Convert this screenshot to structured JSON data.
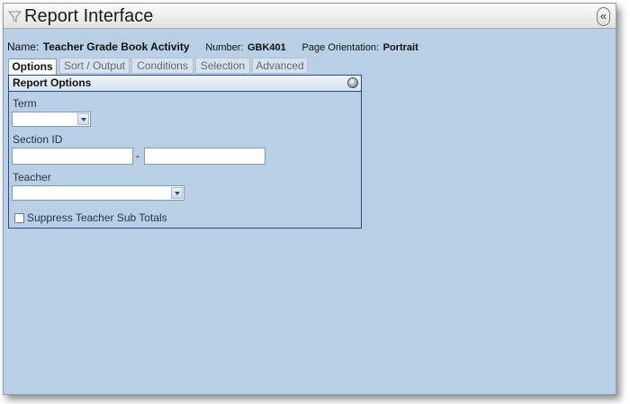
{
  "window": {
    "title": "Report Interface",
    "collapse_glyph": "«"
  },
  "report": {
    "name_label": "Name:",
    "name": "Teacher Grade Book Activity",
    "number_label": "Number:",
    "number": "GBK401",
    "orientation_label": "Page Orientation:",
    "orientation": "Portrait"
  },
  "tabs": [
    {
      "label": "Options",
      "active": true
    },
    {
      "label": "Sort / Output"
    },
    {
      "label": "Conditions"
    },
    {
      "label": "Selection"
    },
    {
      "label": "Advanced"
    }
  ],
  "panel": {
    "title": "Report Options",
    "term": {
      "label": "Term",
      "value": ""
    },
    "section": {
      "label": "Section ID",
      "from": "",
      "to": "",
      "separator": "-"
    },
    "teacher": {
      "label": "Teacher",
      "value": ""
    },
    "suppress": {
      "label": "Suppress Teacher Sub Totals",
      "checked": false
    }
  },
  "icons": [
    "filter-icon",
    "collapse-icon",
    "dropdown-arrow-icon",
    "panel-collapse-icon"
  ],
  "colors": {
    "background": "#b8cfe6",
    "panel_border": "#2b4d82",
    "title_bar": "#e2e2e2"
  }
}
